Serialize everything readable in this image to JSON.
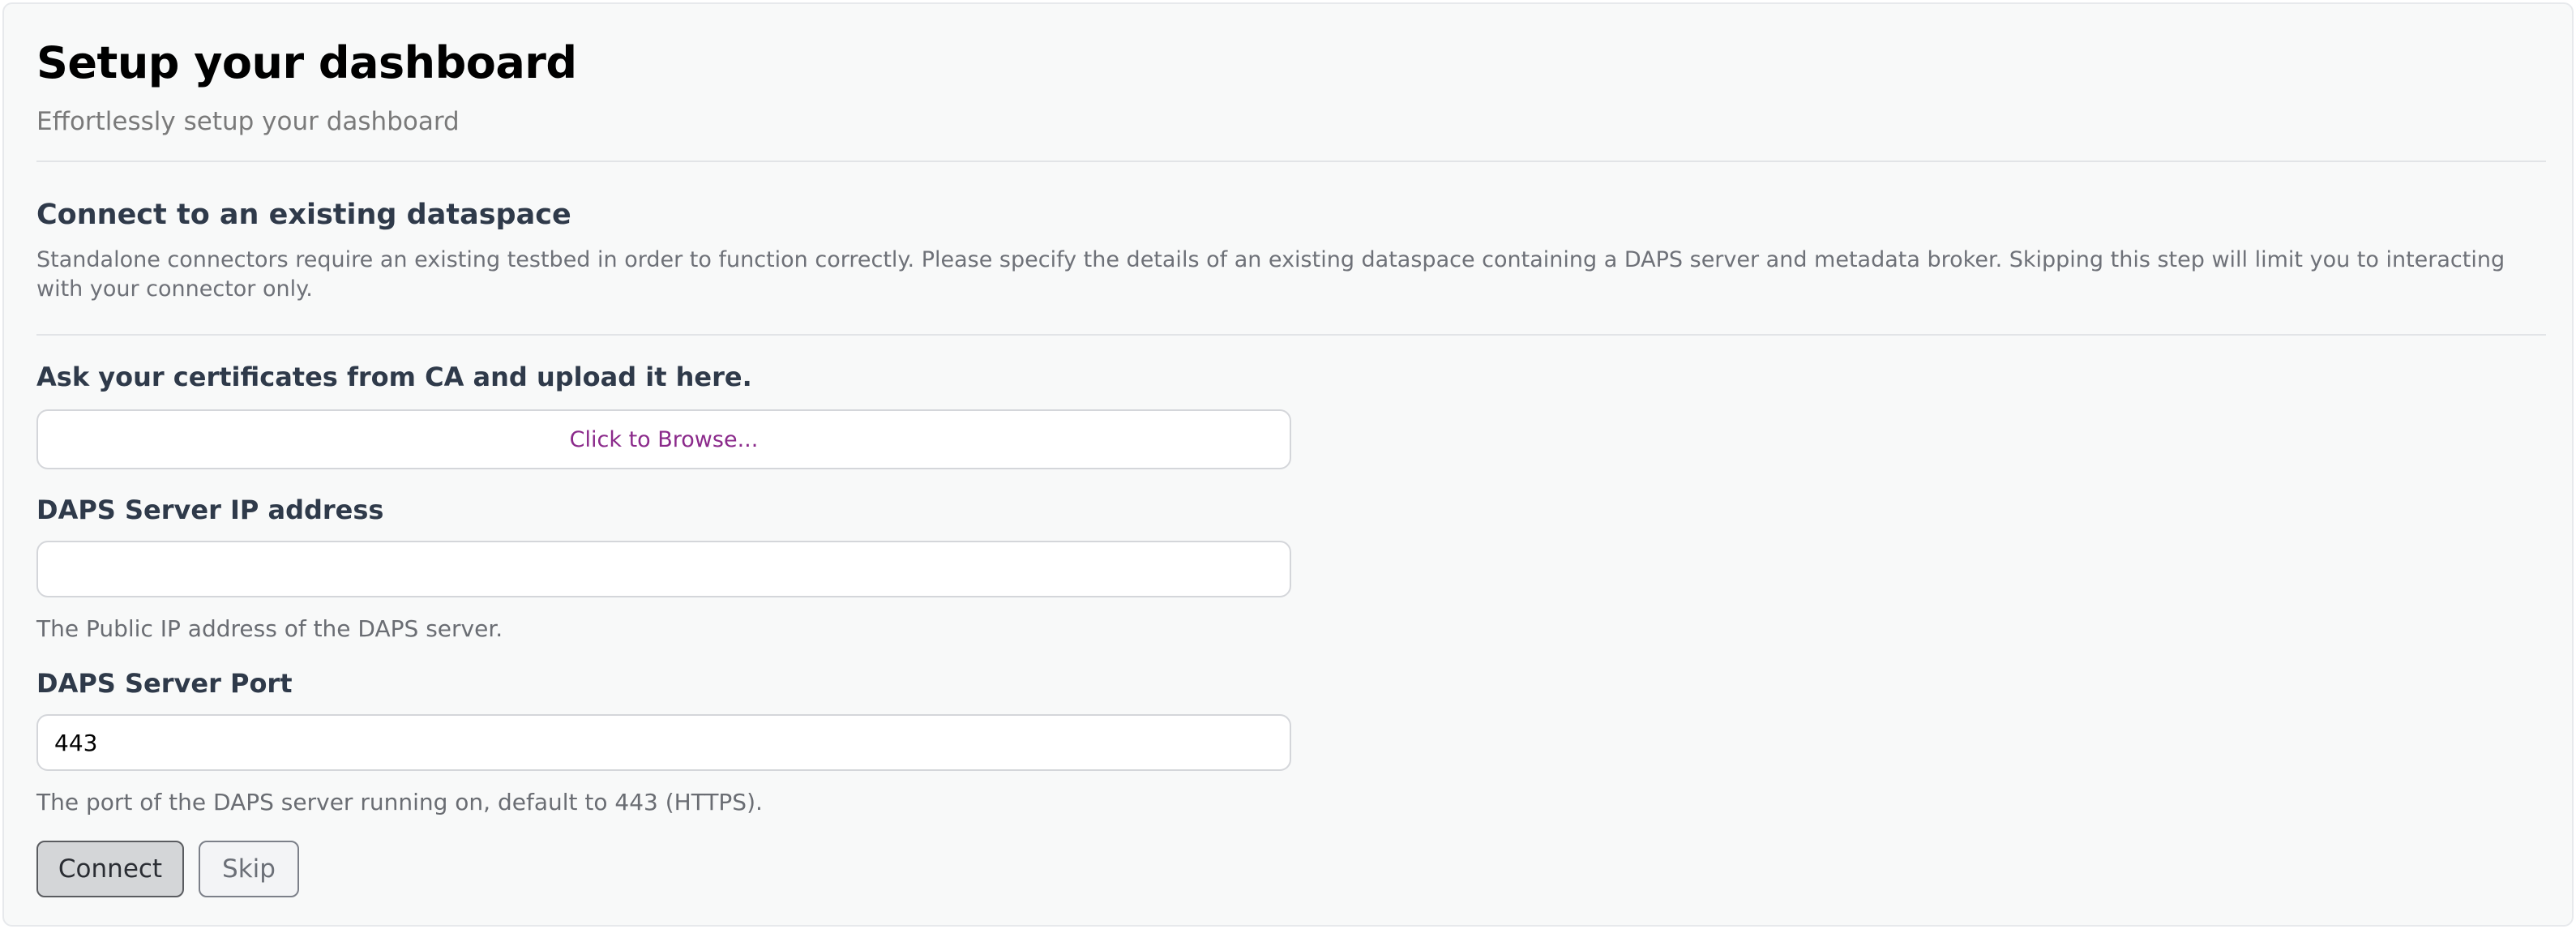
{
  "header": {
    "title": "Setup your dashboard",
    "subtitle": "Effortlessly setup your dashboard"
  },
  "section": {
    "title": "Connect to an existing dataspace",
    "description": "Standalone connectors require an existing testbed in order to function correctly. Please specify the details of an existing dataspace containing a DAPS server and metadata broker. Skipping this step will limit you to interacting with your connector only."
  },
  "certificate": {
    "label": "Ask your certificates from CA and upload it here.",
    "browse_text": "Click to Browse..."
  },
  "daps_ip": {
    "label": "DAPS Server IP address",
    "value": "",
    "help": "The Public IP address of the DAPS server."
  },
  "daps_port": {
    "label": "DAPS Server Port",
    "value": "443",
    "help": "The port of the DAPS server running on, default to 443 (HTTPS)."
  },
  "actions": {
    "connect_label": "Connect",
    "skip_label": "Skip"
  },
  "colors": {
    "browse_link": "#8b2a8b",
    "heading": "#2f3a4a",
    "muted_text": "#6e7178"
  }
}
